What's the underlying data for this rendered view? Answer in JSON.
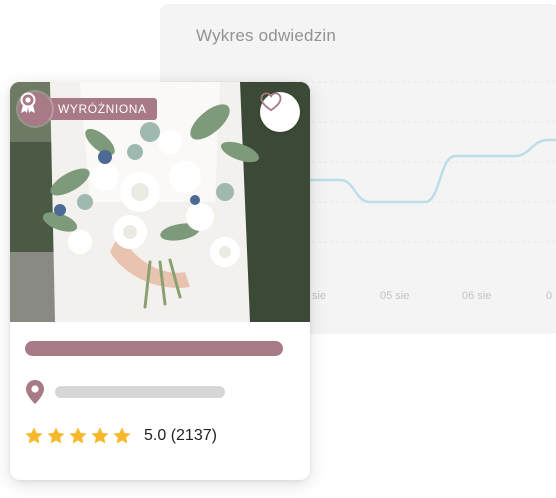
{
  "chart_card": {
    "title": "Wykres odwiedzin",
    "x_labels": [
      "sie",
      "05 sie",
      "06 sie",
      "0"
    ],
    "line_color": "#b7dbe8"
  },
  "listing": {
    "badge_label": "WYRÓŻNIONA",
    "badge_icon": "award-ribbon-icon",
    "favorite_icon": "heart-outline-icon",
    "location_icon": "map-pin-icon",
    "rating_value": "5.0",
    "rating_count": "(2137)",
    "stars_filled": 5,
    "accent_color": "#a77a85",
    "star_color": "#f6b92b"
  }
}
